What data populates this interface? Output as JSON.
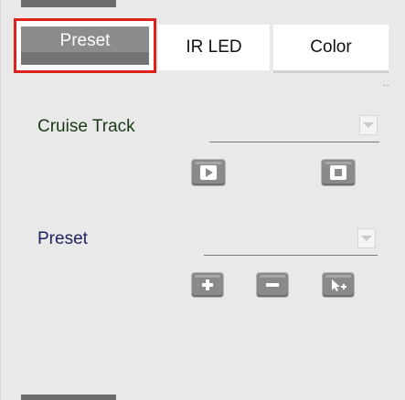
{
  "tabs": [
    {
      "label": "Preset",
      "active": true,
      "highlighted": true
    },
    {
      "label": "IR LED",
      "active": false
    },
    {
      "label": "Color",
      "active": false
    }
  ],
  "more_indicator": "..",
  "cruise": {
    "label": "Cruise Track",
    "selected_value": "",
    "buttons": {
      "play_icon": "play-icon",
      "stop_icon": "stop-icon"
    }
  },
  "preset": {
    "label": "Preset",
    "selected_value": "",
    "buttons": {
      "add_icon": "plus-icon",
      "remove_icon": "minus-icon",
      "goto_icon": "cursor-icon"
    }
  },
  "colors": {
    "highlight_border": "#e0201a",
    "active_tab": "#8c8c8c",
    "panel_bg": "#e9e9e9",
    "button": "#8a8a8a"
  }
}
